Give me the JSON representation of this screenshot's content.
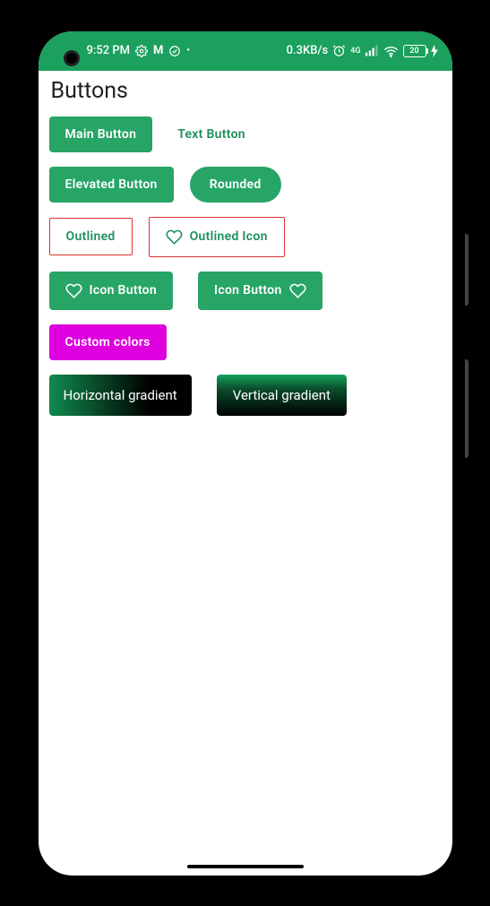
{
  "status": {
    "time": "9:52 PM",
    "data_rate": "0.3KB/s",
    "battery": "20"
  },
  "page": {
    "title": "Buttons"
  },
  "buttons": {
    "main": "Main Button",
    "text": "Text Button",
    "elevated": "Elevated Button",
    "rounded": "Rounded",
    "outlined": "Outlined",
    "outlined_icon": "Outlined Icon",
    "icon_left": "Icon Button",
    "icon_right": "Icon Button",
    "custom": "Custom colors",
    "grad_h": "Horizontal gradient",
    "grad_v": "Vertical gradient"
  }
}
